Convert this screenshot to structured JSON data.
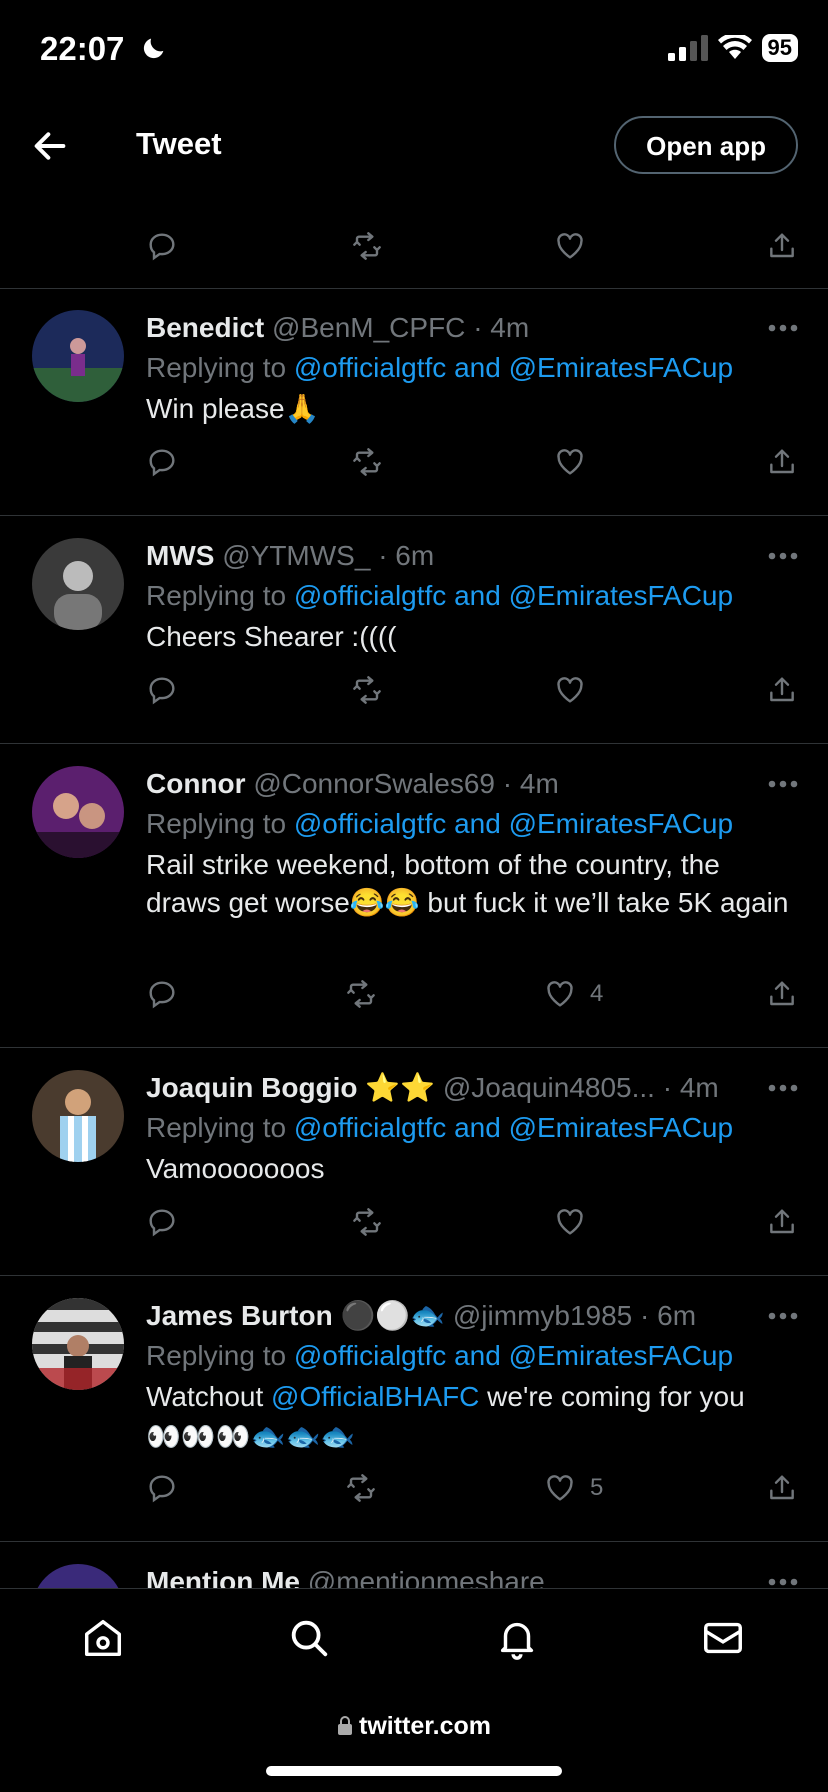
{
  "status": {
    "time": "22:07",
    "battery": "95"
  },
  "header": {
    "title": "Tweet",
    "open_app": "Open app"
  },
  "tweets": [
    {
      "name": "Benedict",
      "handle": "@BenM_CPFC",
      "time": "· 4m",
      "replying": "Replying to",
      "mentions": "@officialgtfc and @EmiratesFACup",
      "text": "Win please🙏",
      "likes": ""
    },
    {
      "name": "MWS",
      "handle": "@YTMWS_",
      "time": "· 6m",
      "replying": "Replying to",
      "mentions": "@officialgtfc and @EmiratesFACup",
      "text": "Cheers Shearer :((((",
      "likes": ""
    },
    {
      "name": "Connor",
      "handle": "@ConnorSwales69",
      "time": "· 4m",
      "replying": "Replying to",
      "mentions": "@officialgtfc and @EmiratesFACup",
      "text": "Rail strike weekend, bottom of the country, the draws get worse😂😂 but fuck it we’ll take 5K again",
      "likes": "4"
    },
    {
      "name": "Joaquin Boggio",
      "name_emoji": "⭐⭐",
      "handle": "@Joaquin4805...",
      "time": "· 4m",
      "replying": "Replying to",
      "mentions": "@officialgtfc and @EmiratesFACup",
      "text": "Vamooooooos",
      "likes": ""
    },
    {
      "name": "James Burton",
      "name_emoji": "⚫⚪🐟",
      "handle": "@jimmyb1985",
      "time": "· 6m",
      "replying": "Replying to",
      "mentions": "@officialgtfc and @EmiratesFACup",
      "text_pre": "Watchout ",
      "text_link": "@OfficialBHAFC",
      "text_post": " we're coming for you",
      "text_line2": "👀👀👀🐟🐟🐟",
      "likes": "5"
    },
    {
      "name": "Mention Me",
      "handle": "@mentionmeshare"
    }
  ],
  "browser": {
    "url": "twitter.com"
  },
  "colors": {
    "accent": "#1d9bf0",
    "muted": "#71767b",
    "text": "#e7e9ea",
    "divider": "#2f3336"
  }
}
